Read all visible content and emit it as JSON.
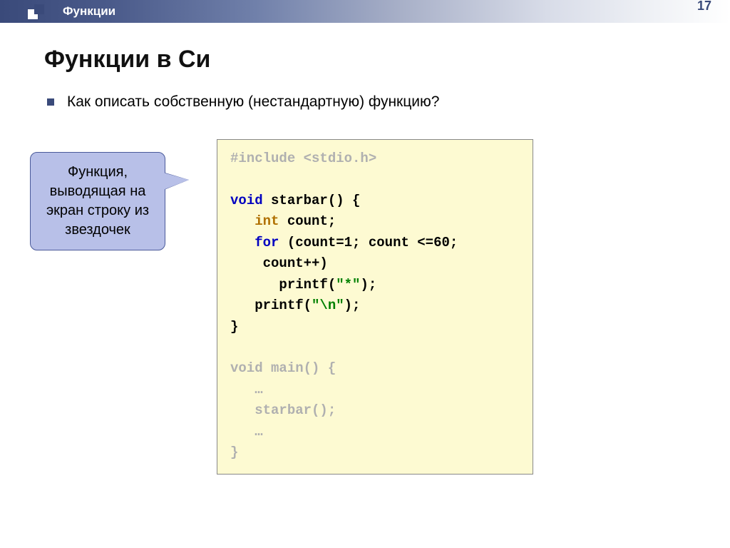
{
  "header": {
    "label": "Функции"
  },
  "page_number": "17",
  "title": "Функции в Си",
  "bullet": "Как описать собственную (нестандартную) функцию?",
  "callout": "Функция, выводящая на экран строку из звездочек",
  "code": {
    "l1": "#include <stdio.h>",
    "l2": "",
    "l3a": "void",
    "l3b": " starbar() {",
    "l4a": "   ",
    "l4b": "int",
    "l4c": " count;",
    "l5a": "   ",
    "l5b": "for",
    "l5c": " (count=1; count <=60;",
    "l5d": "    count++)",
    "l6a": "      printf(",
    "l6b": "\"*\"",
    "l6c": ");",
    "l7a": "   printf(",
    "l7b": "\"\\n\"",
    "l7c": ");",
    "l8": "}",
    "l9": "",
    "l10": "void main() {",
    "l11": "   …",
    "l12": "   starbar();",
    "l13": "   …",
    "l14": "}"
  }
}
